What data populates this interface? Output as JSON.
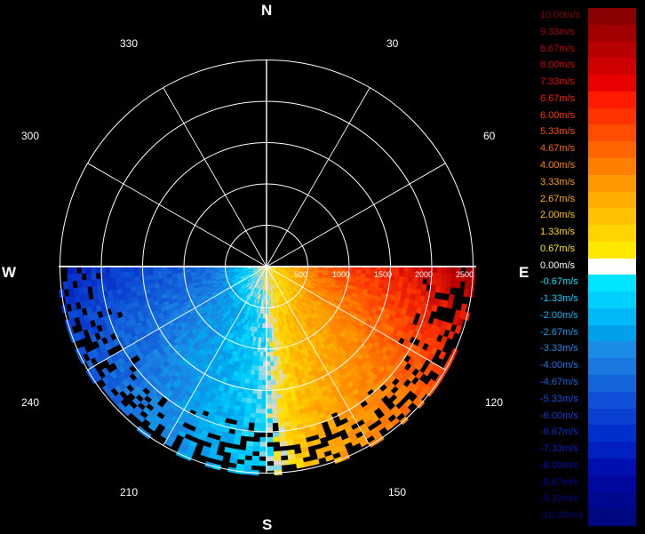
{
  "compass": {
    "n": "N",
    "e": "E",
    "s": "S",
    "w": "W"
  },
  "bearings": [
    "330",
    "30",
    "300",
    "60",
    "240",
    "120",
    "210",
    "150"
  ],
  "range_labels": [
    "500",
    "1000",
    "1500",
    "2000",
    "2500"
  ],
  "legend": {
    "labels": [
      "10.00m/s",
      "9.33m/s",
      "8.67m/s",
      "8.00m/s",
      "7.33m/s",
      "6.67m/s",
      "6.00m/s",
      "5.33m/s",
      "4.67m/s",
      "4.00m/s",
      "3.33m/s",
      "2.67m/s",
      "2.00m/s",
      "1.33m/s",
      "0.67m/s",
      "0.00m/s",
      "-0.67m/s",
      "-1.33m/s",
      "-2.00m/s",
      "-2.67m/s",
      "-3.33m/s",
      "-4.00m/s",
      "-4.67m/s",
      "-5.33m/s",
      "-6.00m/s",
      "-6.67m/s",
      "-7.33m/s",
      "-8.00m/s",
      "-8.67m/s",
      "-9.33m/s",
      "-10.00m/s"
    ],
    "colors": [
      "#8b0000",
      "#a00000",
      "#b80000",
      "#d00000",
      "#e80000",
      "#ff1a00",
      "#ff3300",
      "#ff4d00",
      "#ff6600",
      "#ff8000",
      "#ff9900",
      "#ffad00",
      "#ffc000",
      "#ffd400",
      "#ffe800",
      "#ffffff",
      "#00e5ff",
      "#00d0ff",
      "#00b8f5",
      "#00a0eb",
      "#1a8ce6",
      "#1a78e0",
      "#1464dc",
      "#1050d8",
      "#0a40d2",
      "#0030cc",
      "#0020c0",
      "#0010b0",
      "#0008a0",
      "#000890",
      "#000880"
    ]
  }
}
